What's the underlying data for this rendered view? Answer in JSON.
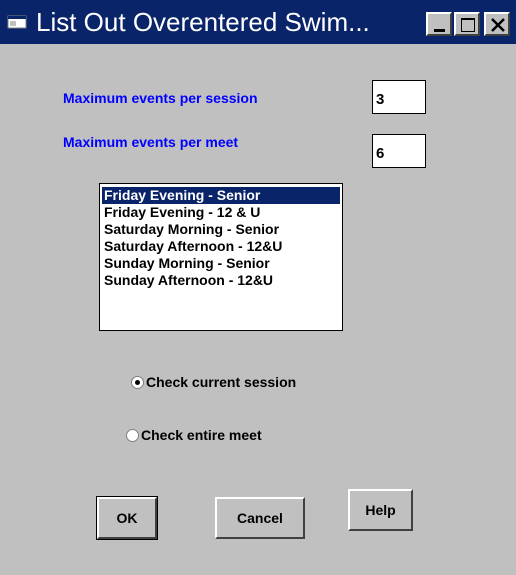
{
  "window": {
    "title": "List Out Overentered Swim...",
    "buttons": {
      "minimize": "minimize-icon",
      "maximize": "maximize-icon",
      "close": "close-icon"
    }
  },
  "fields": {
    "max_per_session": {
      "label": "Maximum events per session",
      "value": "3"
    },
    "max_per_meet": {
      "label": "Maximum events per meet",
      "value": "6"
    }
  },
  "sessions": {
    "selected_index": 0,
    "items": [
      "Friday Evening - Senior",
      "Friday Evening - 12 & U",
      "Saturday Morning - Senior",
      "Saturday Afternoon - 12&U",
      "Sunday Morning - Senior",
      "Sunday Afternoon - 12&U"
    ]
  },
  "scope": {
    "current_session": {
      "label": "Check current session",
      "checked": true
    },
    "entire_meet": {
      "label": "Check entire meet",
      "checked": false
    }
  },
  "actions": {
    "ok": "OK",
    "cancel": "Cancel",
    "help": "Help"
  },
  "colors": {
    "titlebar": "#0a246a",
    "dialog_bg": "#c0c0c0",
    "label_text": "#0000ff",
    "selection": "#0a246a"
  }
}
